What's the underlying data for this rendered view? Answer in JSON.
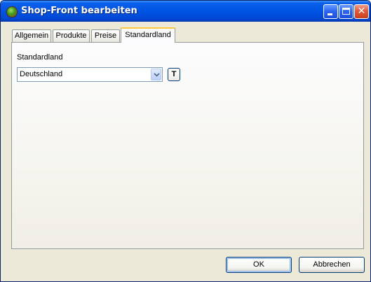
{
  "window": {
    "title": "Shop-Front bearbeiten",
    "icons": {
      "app": "app-globe-icon",
      "minimize": "minimize-icon",
      "maximize": "maximize-icon",
      "close": "close-icon"
    },
    "colors": {
      "titlebar": "#0055E5",
      "face": "#ECE9D8",
      "active_tab_accent": "#FFC83C"
    }
  },
  "tabs": [
    {
      "label": "Allgemein",
      "active": false
    },
    {
      "label": "Produkte",
      "active": false
    },
    {
      "label": "Preise",
      "active": false
    },
    {
      "label": "Standardland",
      "active": true
    }
  ],
  "standardland": {
    "label": "Standardland",
    "selected": "Deutschland",
    "dropdown_icon": "chevron-down-icon",
    "translate_button": "T"
  },
  "buttons": {
    "ok": "OK",
    "cancel": "Abbrechen"
  }
}
